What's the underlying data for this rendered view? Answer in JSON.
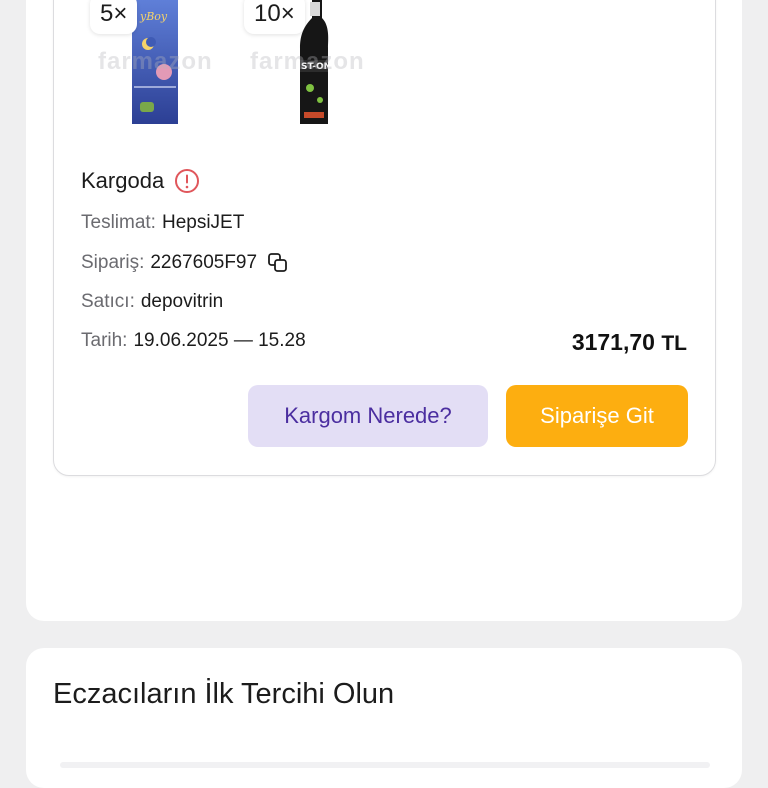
{
  "products": [
    {
      "quantity": "5×",
      "name": "Fairy Bay",
      "watermark": "farmazon"
    },
    {
      "quantity": "10×",
      "name": "ST-ON",
      "watermark": "farmazon"
    }
  ],
  "order": {
    "status": "Kargoda",
    "delivery_label": "Teslimat:",
    "delivery_value": "HepsiJET",
    "order_label": "Sipariş:",
    "order_value": "2267605F97",
    "seller_label": "Satıcı:",
    "seller_value": "depovitrin",
    "date_label": "Tarih:",
    "date_value": "19.06.2025 — 15.28",
    "price_main": "3171,70",
    "price_currency": "TL",
    "track_button": "Kargom Nerede?",
    "go_button": "Siparişe Git"
  },
  "section": {
    "title": "Eczacıların İlk Tercihi Olun"
  },
  "colors": {
    "accent_orange": "#fdae10",
    "accent_purple": "#4b2ea0",
    "purple_bg": "#e3def5",
    "alert_red": "#e0565b"
  }
}
